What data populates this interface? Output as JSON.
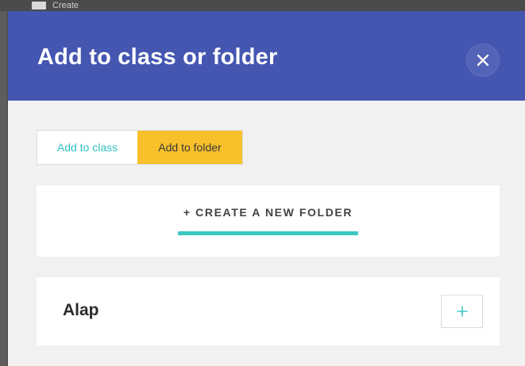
{
  "background": {
    "create_label": "Create"
  },
  "modal": {
    "title": "Add to class or folder",
    "close_icon": "close-icon",
    "tabs": [
      {
        "label": "Add to class",
        "active": false
      },
      {
        "label": "Add to folder",
        "active": true
      }
    ],
    "create_folder_label": "+ CREATE A NEW FOLDER",
    "folders": [
      {
        "name": "Alap",
        "action_icon": "plus-icon"
      }
    ]
  },
  "colors": {
    "header": "#4556b1",
    "active_tab": "#f8c02b",
    "accent": "#3bc6c4",
    "modal_bg": "#f1f1f1"
  }
}
